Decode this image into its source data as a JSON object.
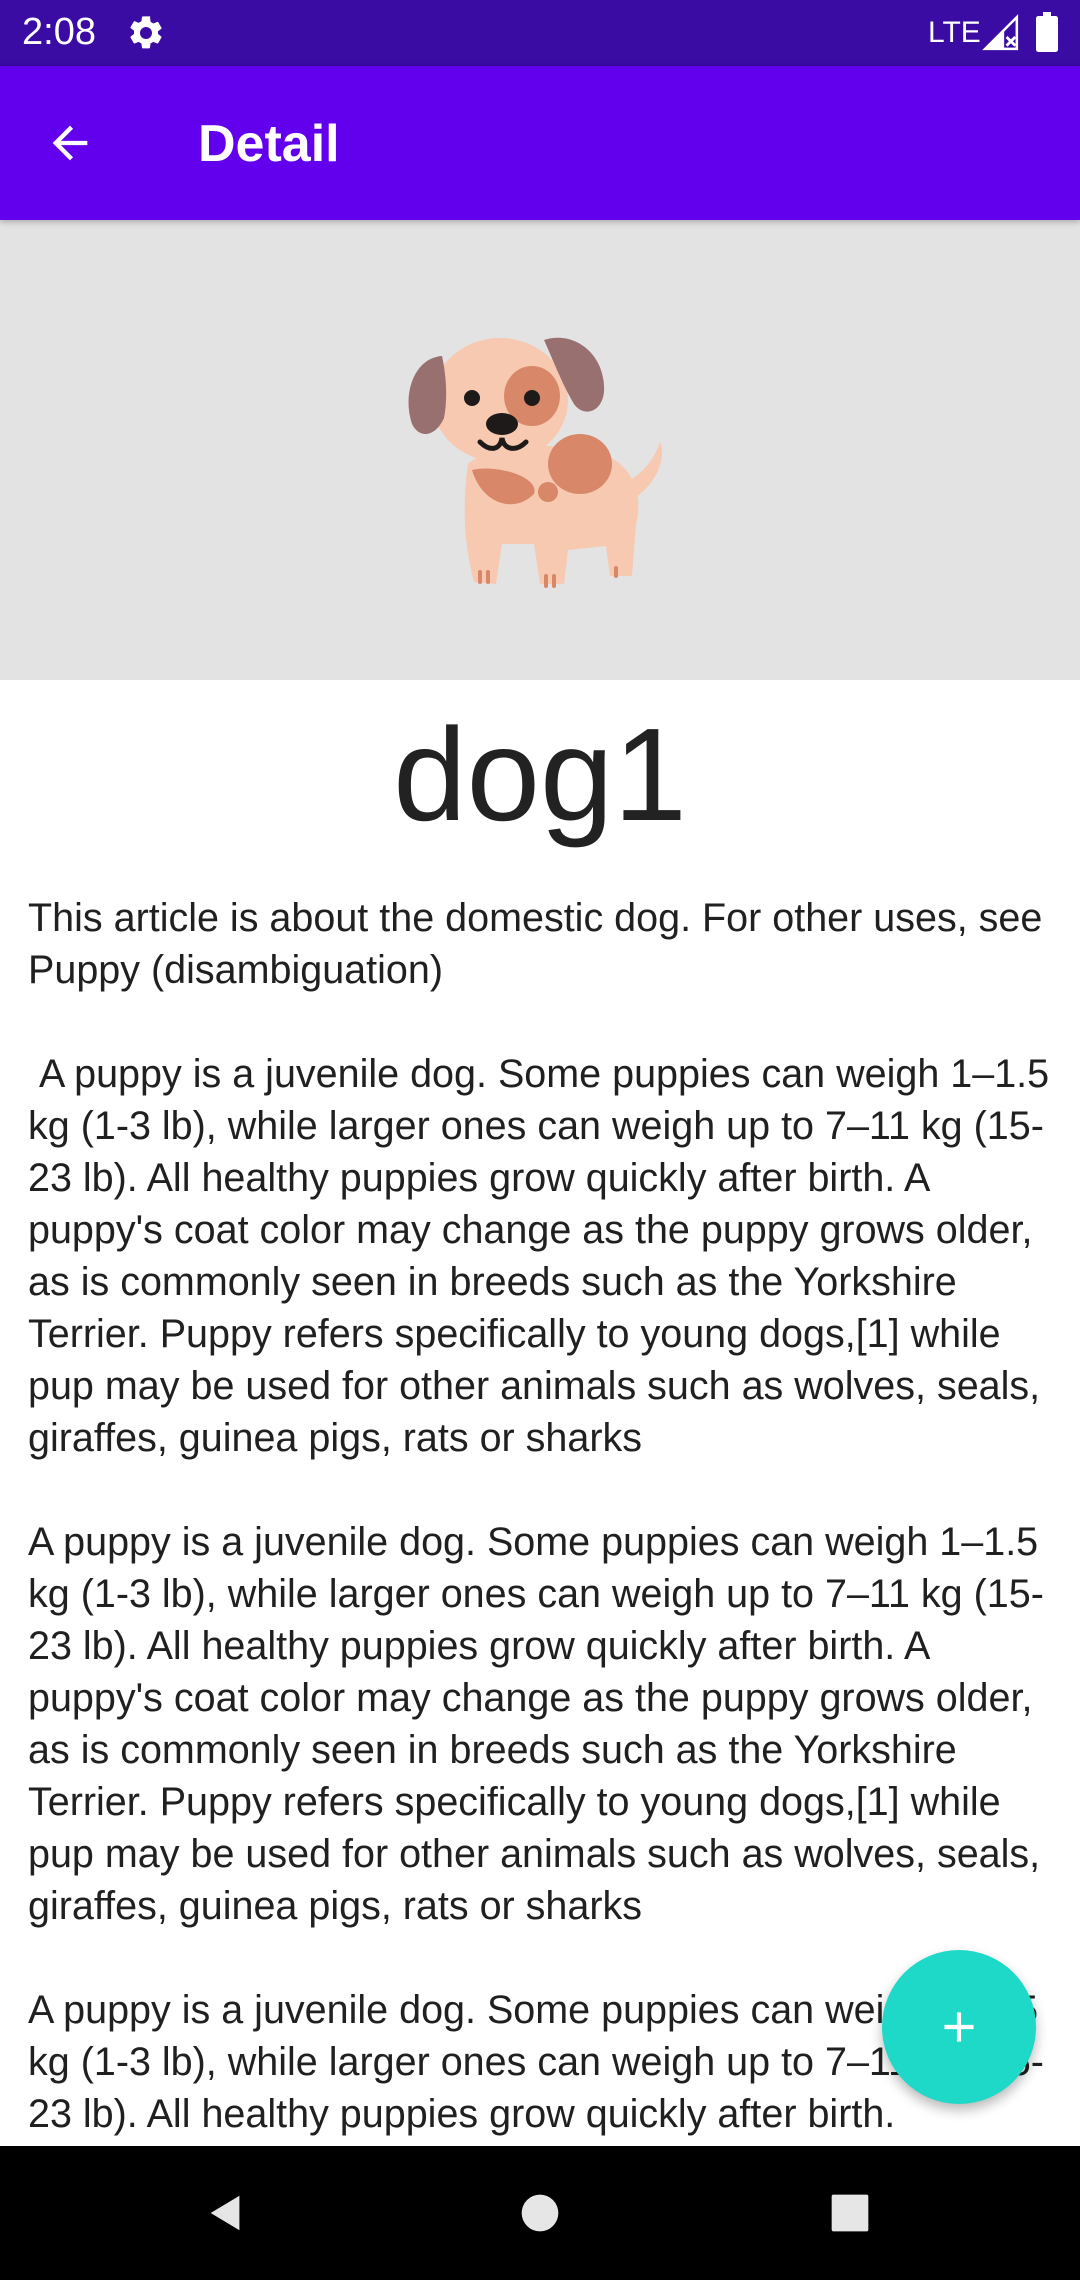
{
  "status_bar": {
    "time": "2:08",
    "network": "LTE",
    "icons": [
      "gear-icon",
      "signal-icon",
      "battery-icon"
    ]
  },
  "app_bar": {
    "title": "Detail",
    "back_icon": "arrow-back-icon",
    "color": "#6200ee"
  },
  "hero": {
    "image": "puppy-illustration",
    "background": "#e3e3e4"
  },
  "detail": {
    "name": "dog1",
    "description": "This article is about the domestic dog. For other uses, see Puppy (disambiguation)\n\n A puppy is a juvenile dog. Some puppies can weigh 1–1.5 kg (1-3 lb), while larger ones can weigh up to 7–11 kg (15-23 lb). All healthy puppies grow quickly after birth. A puppy's coat color may change as the puppy grows older, as is commonly seen in breeds such as the Yorkshire Terrier. Puppy refers specifically to young dogs,[1] while pup may be used for other animals such as wolves, seals, giraffes, guinea pigs, rats or sharks\n\nA puppy is a juvenile dog. Some puppies can weigh 1–1.5 kg (1-3 lb), while larger ones can weigh up to 7–11 kg (15-23 lb). All healthy puppies grow quickly after birth. A puppy's coat color may change as the puppy grows older, as is commonly seen in breeds such as the Yorkshire Terrier. Puppy refers specifically to young dogs,[1] while pup may be used for other animals such as wolves, seals, giraffes, guinea pigs, rats or sharks\n\nA puppy is a juvenile dog. Some puppies can weigh 1–1.5 kg (1-3 lb), while larger ones can weigh up to 7–11 kg (15-23 lb). All healthy puppies grow quickly after birth."
  },
  "fab": {
    "icon": "plus-icon",
    "color": "#1ed9c8"
  },
  "nav_bar": {
    "buttons": [
      "back-triangle-icon",
      "home-circle-icon",
      "recents-square-icon"
    ]
  }
}
